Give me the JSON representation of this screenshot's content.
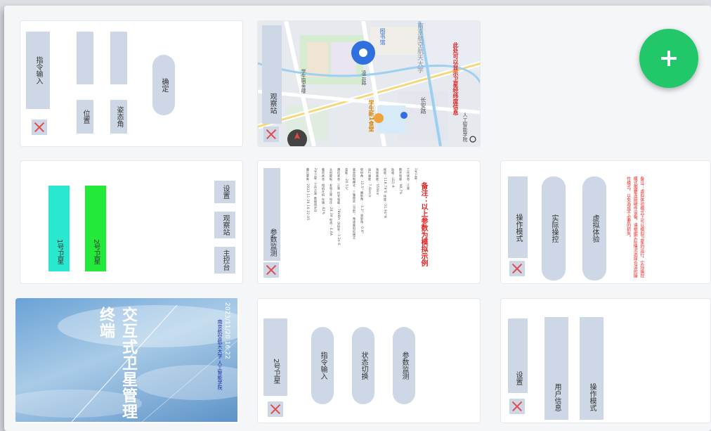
{
  "colors": {
    "tile": "#cdd7e5",
    "accent_green": "#22c76a",
    "sat1": "#29e8cf",
    "sat2": "#22e93a",
    "warning_red": "#e52222"
  },
  "cards": {
    "command_input": {
      "title": "指令输入",
      "fields": [
        "位置",
        "姿态角"
      ],
      "confirm_label": "确定"
    },
    "observatory": {
      "title": "观察站",
      "map_labels": [
        "学生新1食堂",
        "图书馆",
        "长安路",
        "凌云路",
        "南京航空航天大学",
        "学生宿舍楼",
        "人工智能学院"
      ],
      "map_note": "此处可以显示卫星经纬度信息"
    },
    "satellites": {
      "sat1_label": "1号卫星",
      "sat2_label": "2号卫星",
      "buttons": [
        "设置",
        "观察站",
        "主控台"
      ]
    },
    "param_monitor": {
      "title": "参数监测",
      "lines": [
        "1号卫星：",
        "工作状态：正常",
        "剩余电量：98.7%",
        "轨道：LEO-A",
        "经度：118.79°E  纬度：31.94°N",
        "海拔高度：550km",
        "运行速度：7.6km/s",
        "俯仰角：12.5°  偏航角：-3.2°  滚转角：0.8°",
        "姿态控制模式：三轴稳定（当前），角速度阻尼模式",
        "温度：-20.5℃",
        "通信状态：正常 信号强度：-78dBm 误码率：1.2e-6",
        "太阳能板：发电正常 电压：28.3V 电流：4.6A",
        "载荷状态：相机开机 存储：62%",
        "2号卫星：工作正常 数据同步中",
        "最后更新：2023-11-20 16:22:05"
      ],
      "note": "备注：以上参数为模拟示例"
    },
    "operation_mode": {
      "title": "操作模式",
      "options": [
        "实际操控",
        "虚拟体验"
      ],
      "note": "备注：虚拟体验模式下可以模拟卫星的运行，实际操控模式需要连接硬件设备，请根据实际情况选择合适的操作模式，以免造成不必要的损失。"
    },
    "splash": {
      "title": "交互式卫星管理终端",
      "time": "2023/11/20 16:22",
      "footer": "南京航空航天大学 人工智能学院"
    },
    "sat2_menu": {
      "title": "2号卫星",
      "options": [
        "指令输入",
        "状态切换",
        "参数监测"
      ]
    },
    "settings": {
      "title": "设置",
      "options": [
        "用户信息",
        "操作模式"
      ]
    }
  }
}
